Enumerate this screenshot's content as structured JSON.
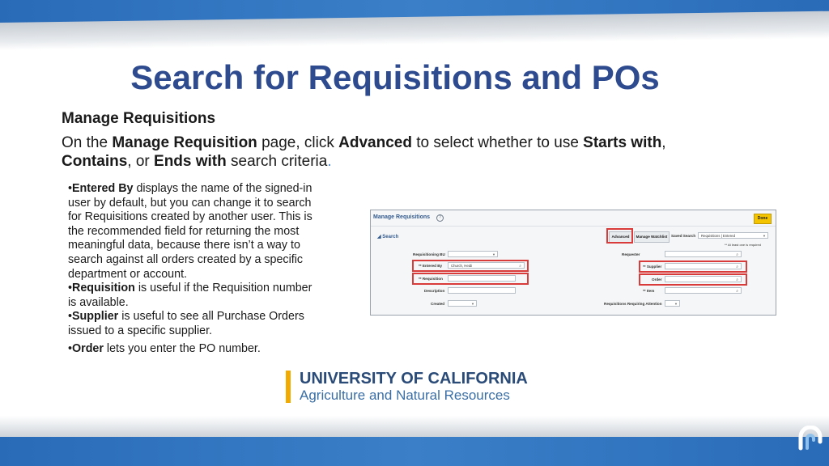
{
  "slide": {
    "title": "Search for Requisitions and POs",
    "subheading": "Manage Requisitions",
    "intro": {
      "p1": "On the ",
      "b1": "Manage Requisition",
      "p2": " page, click ",
      "b2": "Advanced",
      "p3": " to select whether to use ",
      "b3": "Starts with",
      "p4": ",",
      "b4": "Contains",
      "p5": ", or ",
      "b5": "Ends with",
      "p6": " search criteria",
      "p7": "."
    },
    "bullets": [
      {
        "bold": "Entered By",
        "text": " displays the name of the signed-in user by default, but you can change it to search for Requisitions created by another user.  This is the recommended field for returning the most meaningful data, because there isn’t a way to search against all orders created by a specific department or account."
      },
      {
        "bold": "Requisition",
        "text": " is useful if the Requisition number is available."
      },
      {
        "bold": "Supplier",
        "text": " is useful to see all Purchase Orders issued to a specific supplier."
      },
      {
        "bold": "Order",
        "text": " lets you enter the PO number."
      }
    ],
    "bullet_prefix": "•"
  },
  "screenshot": {
    "header": "Manage Requisitions",
    "done": "Done",
    "search": "Search",
    "advanced": "Advanced",
    "manage_watchlist": "Manage Watchlist",
    "saved_search": "Saved Search",
    "saved_search_value": "Requisitions | Entered",
    "required_note": "** At least one is required",
    "labels": {
      "requisitioning_bu": "Requisitioning BU",
      "entered_by": "Entered By",
      "requisition": "Requisition",
      "description": "Description",
      "created": "Created",
      "requester": "Requester",
      "supplier": "Supplier",
      "order": "Order",
      "item": "Item",
      "attention": "Requisitions Requiring Attention"
    },
    "values": {
      "entered_by": "Church, Heidi"
    },
    "required_marker": "**"
  },
  "logo": {
    "line1": "UNIVERSITY OF CALIFORNIA",
    "line2": "Agriculture and Natural Resources"
  },
  "colors": {
    "title": "#2e4b8f",
    "band_blue": "#2a6bb8",
    "highlight_red": "#d93a3a",
    "logo_gold": "#f2a900"
  }
}
